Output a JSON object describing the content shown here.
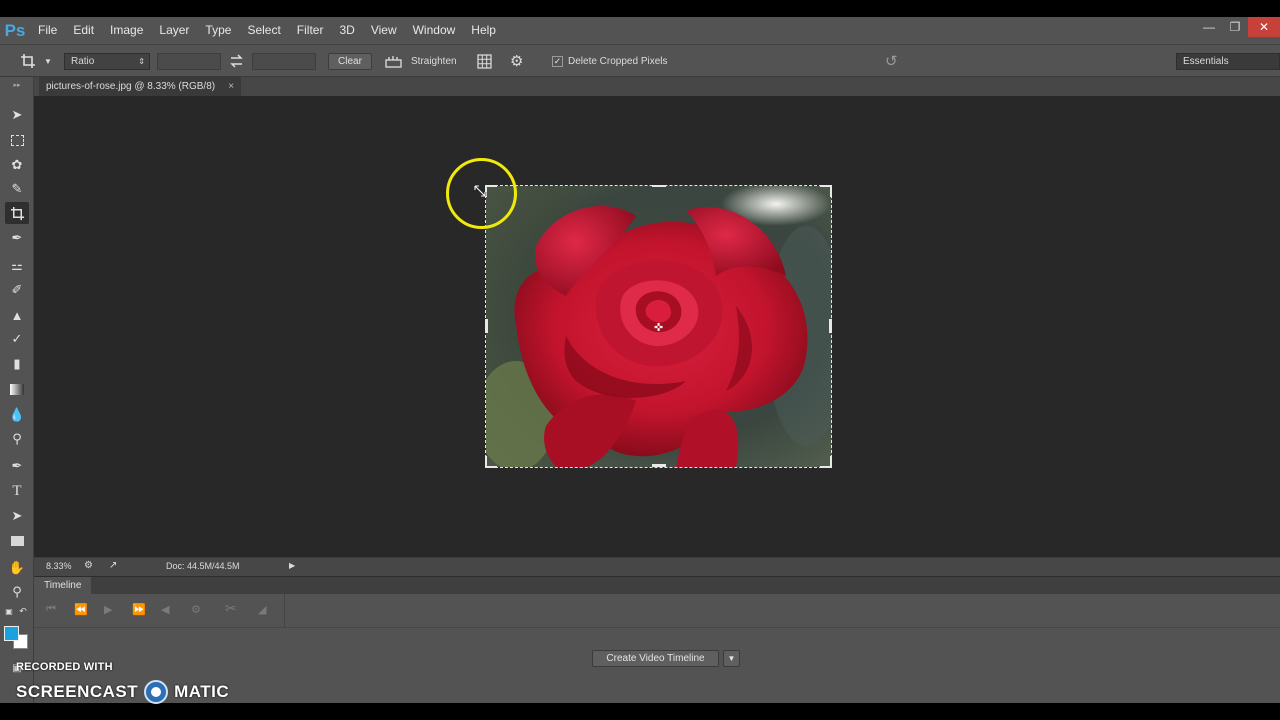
{
  "app": {
    "logo": "Ps"
  },
  "menu": [
    "File",
    "Edit",
    "Image",
    "Layer",
    "Type",
    "Select",
    "Filter",
    "3D",
    "View",
    "Window",
    "Help"
  ],
  "window_controls": {
    "minimize": "—",
    "restore": "❐",
    "close": "✕"
  },
  "options": {
    "ratio_label": "Ratio",
    "width_value": "",
    "height_value": "",
    "clear_label": "Clear",
    "straighten_label": "Straighten",
    "delete_cropped_label": "Delete Cropped Pixels",
    "delete_cropped_checked": true,
    "workspace": "Essentials"
  },
  "document": {
    "tab_title": "pictures-of-rose.jpg @ 8.33% (RGB/8)",
    "close": "×"
  },
  "status": {
    "zoom": "8.33%",
    "doc_size": "Doc: 44.5M/44.5M"
  },
  "timeline": {
    "tab_label": "Timeline",
    "create_button": "Create Video Timeline"
  },
  "colors": {
    "foreground": "#1aa1e0",
    "background": "#ffffff",
    "cursor_highlight": "#f0ea0a"
  },
  "watermark": {
    "recorded_with": "RECORDED WITH",
    "brand_left": "SCREENCAST",
    "brand_right": "MATIC"
  },
  "tools": [
    "move-tool-icon",
    "marquee-tool-icon",
    "lasso-tool-icon",
    "quick-selection-tool-icon",
    "crop-tool-icon",
    "eyedropper-tool-icon",
    "healing-brush-tool-icon",
    "brush-tool-icon",
    "clone-stamp-tool-icon",
    "history-brush-tool-icon",
    "eraser-tool-icon",
    "gradient-tool-icon",
    "blur-tool-icon",
    "dodge-tool-icon",
    "pen-tool-icon",
    "type-tool-icon",
    "path-selection-tool-icon",
    "rectangle-tool-icon",
    "hand-tool-icon",
    "zoom-tool-icon"
  ]
}
